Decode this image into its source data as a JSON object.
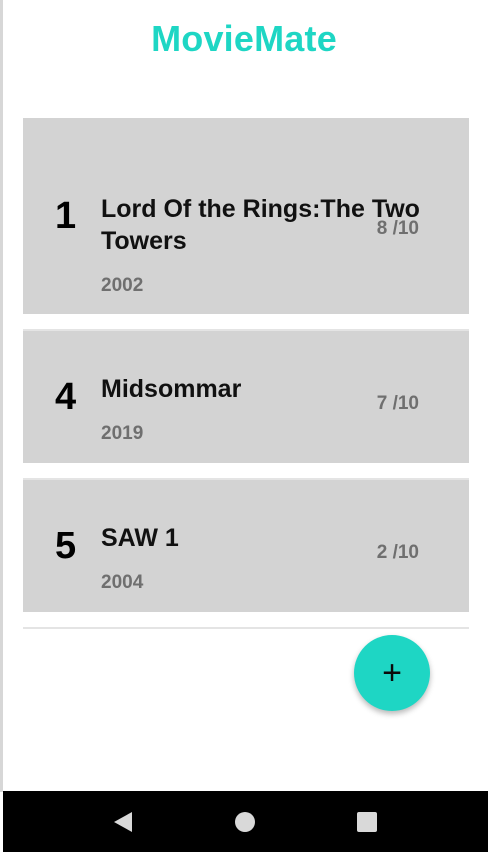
{
  "app": {
    "title": "MovieMate"
  },
  "colors": {
    "accent": "#1ED6C4",
    "card": "#D3D3D3",
    "navbar": "#000000"
  },
  "movies": [
    {
      "rank": "1",
      "title": "Lord Of the Rings:The Two Towers",
      "year": "2002",
      "rating": "8 /10"
    },
    {
      "rank": "4",
      "title": "Midsommar",
      "year": "2019",
      "rating": "7 /10"
    },
    {
      "rank": "5",
      "title": "SAW 1",
      "year": "2004",
      "rating": "2 /10"
    }
  ],
  "fab": {
    "icon": "plus-icon",
    "label": "+"
  },
  "nav": {
    "back_icon": "back-triangle-icon",
    "home_icon": "home-circle-icon",
    "recents_icon": "recents-square-icon"
  }
}
